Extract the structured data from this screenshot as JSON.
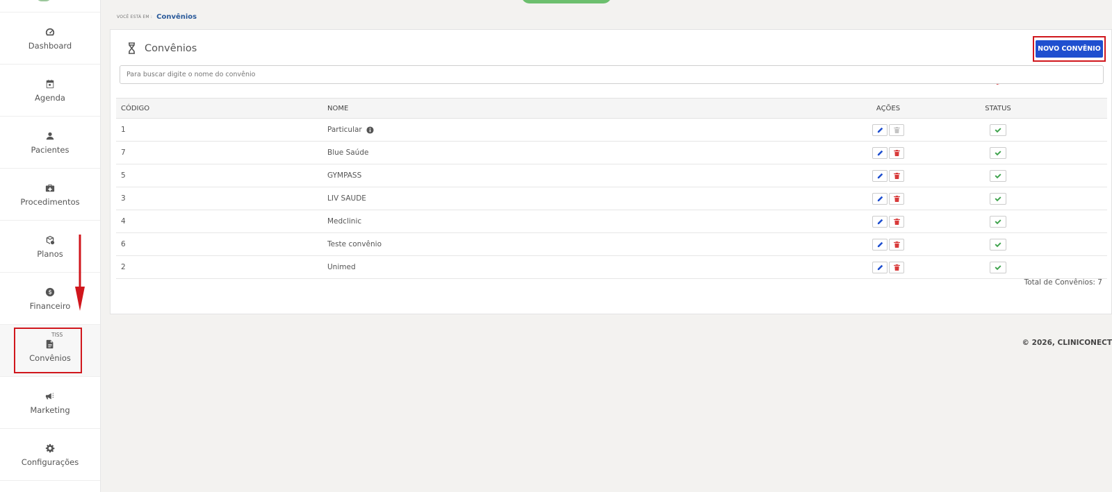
{
  "sidebar": {
    "items": [
      {
        "label": "Dashboard",
        "icon": "dashboard-icon"
      },
      {
        "label": "Agenda",
        "icon": "calendar-icon"
      },
      {
        "label": "Pacientes",
        "icon": "user-icon"
      },
      {
        "label": "Procedimentos",
        "icon": "medical-kit-icon"
      },
      {
        "label": "Planos",
        "icon": "box-icon"
      },
      {
        "label": "Financeiro",
        "icon": "dollar-icon"
      },
      {
        "label": "Convênios",
        "icon": "document-icon",
        "badge": "TISS"
      },
      {
        "label": "Marketing",
        "icon": "megaphone-icon"
      },
      {
        "label": "Configurações",
        "icon": "gear-icon"
      }
    ]
  },
  "breadcrumb": {
    "prefix": "VOCÊ ESTÁ EM :",
    "current": "Convênios"
  },
  "card": {
    "title": "Convênios",
    "new_button": "NOVO CONVÊNIO",
    "search_placeholder": "Para buscar digite o nome do convênio"
  },
  "table": {
    "headers": {
      "code": "CÓDIGO",
      "name": "NOME",
      "actions": "AÇÕES",
      "status": "STATUS"
    },
    "rows": [
      {
        "code": "1",
        "name": "Particular",
        "info": true,
        "delete_enabled": false
      },
      {
        "code": "7",
        "name": "Blue Saúde",
        "info": false,
        "delete_enabled": true
      },
      {
        "code": "5",
        "name": "GYMPASS",
        "info": false,
        "delete_enabled": true
      },
      {
        "code": "3",
        "name": "LIV SAUDE",
        "info": false,
        "delete_enabled": true
      },
      {
        "code": "4",
        "name": "Medclinic",
        "info": false,
        "delete_enabled": true
      },
      {
        "code": "6",
        "name": "Teste convênio",
        "info": false,
        "delete_enabled": true
      },
      {
        "code": "2",
        "name": "Unimed",
        "info": false,
        "delete_enabled": true
      }
    ],
    "total": "Total de Convênios: 7"
  },
  "footer": "© 2026, CLINICONECT",
  "colors": {
    "primary_button": "#1f4fcf",
    "annotation_red": "#d0161c",
    "edit_blue": "#1f4fcf",
    "delete_red": "#d83a3a",
    "status_green": "#3fa34d"
  }
}
